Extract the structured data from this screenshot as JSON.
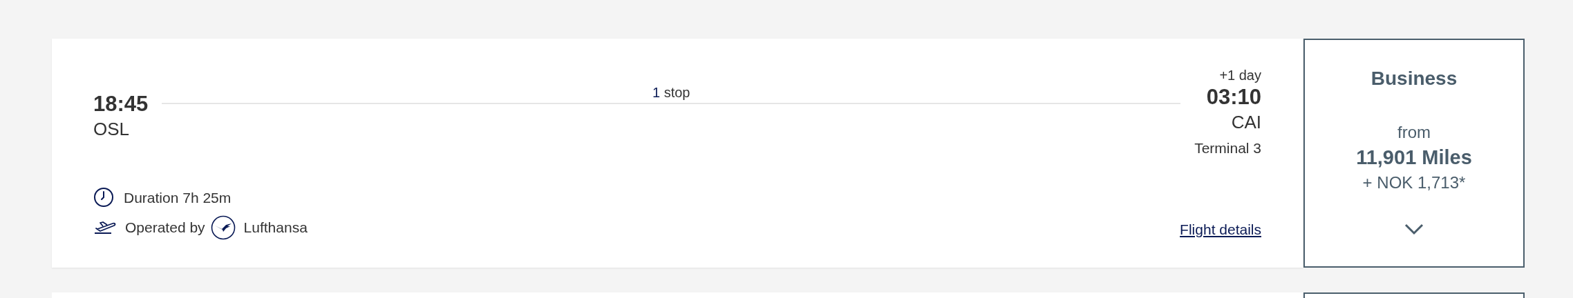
{
  "flight": {
    "departure": {
      "time": "18:45",
      "airport": "OSL"
    },
    "stops": {
      "count": "1",
      "label": "stop"
    },
    "arrival": {
      "day_offset": "+1 day",
      "time": "03:10",
      "airport": "CAI",
      "terminal": "Terminal 3"
    },
    "duration": "Duration 7h 25m",
    "operated_by": {
      "label": "Operated by",
      "airline": "Lufthansa"
    },
    "details_link": "Flight details"
  },
  "fare": {
    "cabin": "Business",
    "from": "from",
    "miles": "11,901 Miles",
    "cash": "+ NOK 1,713*",
    "expanded": false
  }
}
